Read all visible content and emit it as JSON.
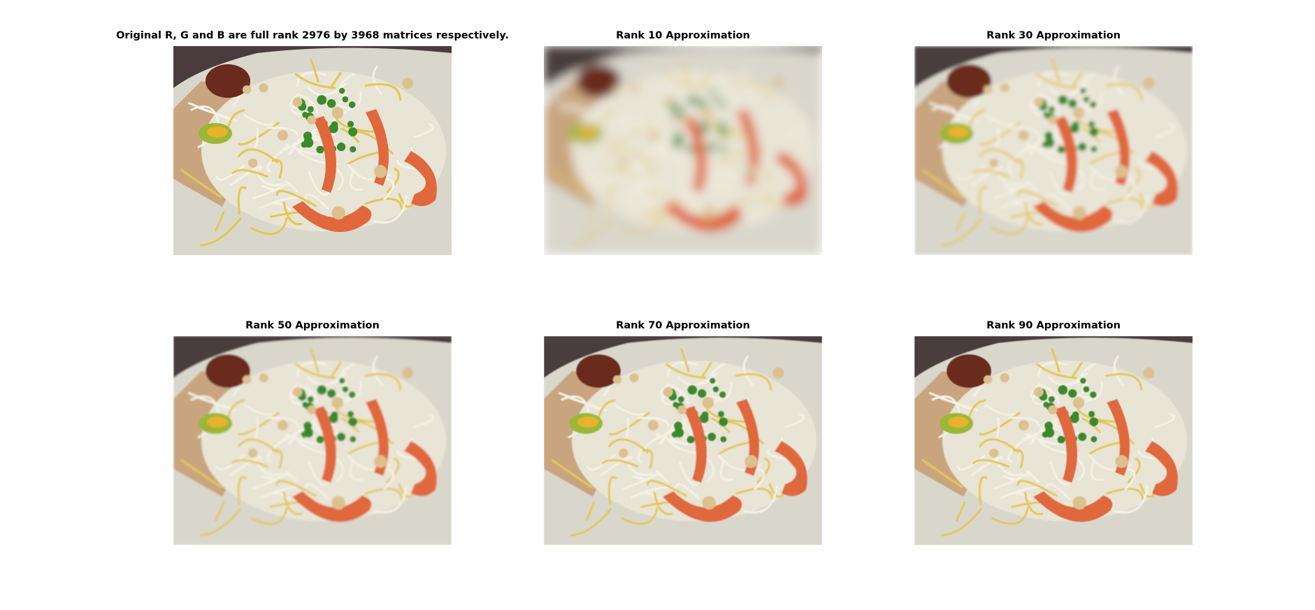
{
  "figure": {
    "panels": [
      {
        "title": "Original R, G and B are full rank 2976 by 3968 matrices respectively.",
        "rank": null
      },
      {
        "title": "Rank 10 Approximation",
        "rank": 10
      },
      {
        "title": "Rank 30 Approximation",
        "rank": 30
      },
      {
        "title": "Rank 50 Approximation",
        "rank": 50
      },
      {
        "title": "Rank 70 Approximation",
        "rank": 70
      },
      {
        "title": "Rank 90 Approximation",
        "rank": 90
      }
    ]
  },
  "colors": {
    "background": "#ffffff",
    "table": "#4a3c3e",
    "plate": "#d9d7cc",
    "leaf": "#c9a57f",
    "noodle_white": "#e8e4d6",
    "noodle_yellow": "#e4c750",
    "shrimp": "#e0683c",
    "scallion": "#3b8a2c",
    "sambal": "#6a2a1e",
    "lime": "#9ab836"
  }
}
